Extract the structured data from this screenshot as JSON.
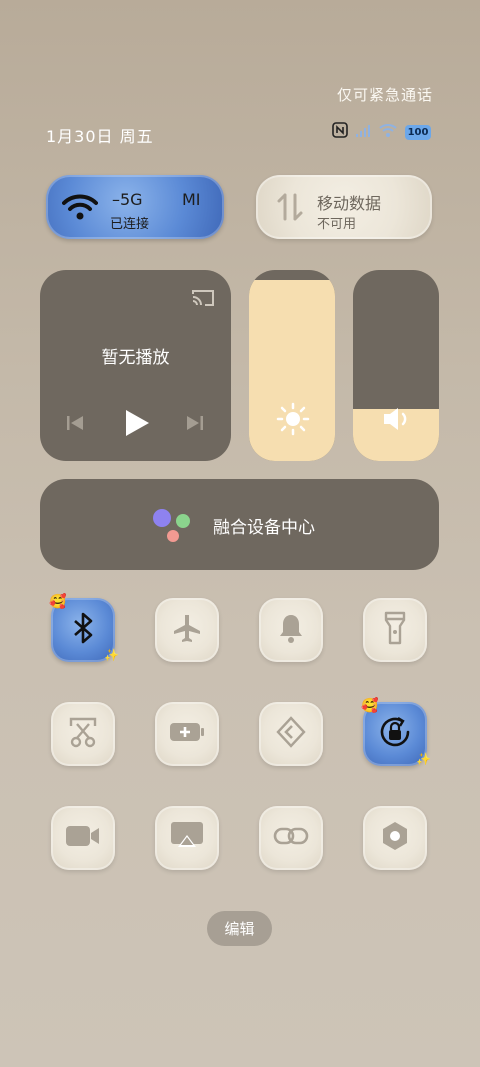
{
  "status_bar": {
    "emergency_text": "仅可紧急通话",
    "date": "1月30日 周五",
    "battery": "100",
    "icons": [
      "nfc-icon",
      "signal-icon",
      "wifi-icon",
      "battery-icon"
    ]
  },
  "wifi_tile": {
    "title": "5G",
    "ssid_partial": "MI",
    "subtitle": "已连接",
    "state": "on"
  },
  "data_tile": {
    "title": "移动数据",
    "subtitle": "不可用",
    "state": "off"
  },
  "media": {
    "status": "暂无播放",
    "icons": [
      "cast-icon",
      "previous-icon",
      "play-icon",
      "next-icon"
    ]
  },
  "brightness": {
    "level": 0.95
  },
  "volume": {
    "level": 0.27
  },
  "device_center": {
    "label": "融合设备中心"
  },
  "tiles": [
    {
      "icon": "bluetooth-icon",
      "state": "on"
    },
    {
      "icon": "airplane-icon",
      "state": "off"
    },
    {
      "icon": "bell-icon",
      "state": "off"
    },
    {
      "icon": "flashlight-icon",
      "state": "off"
    },
    {
      "icon": "screenshot-icon",
      "state": "off"
    },
    {
      "icon": "battery-saver-icon",
      "state": "off"
    },
    {
      "icon": "code-icon",
      "state": "off"
    },
    {
      "icon": "rotation-lock-icon",
      "state": "on"
    },
    {
      "icon": "video-icon",
      "state": "off"
    },
    {
      "icon": "screen-cast-icon",
      "state": "off"
    },
    {
      "icon": "link-icon",
      "state": "off"
    },
    {
      "icon": "settings-icon",
      "state": "off"
    }
  ],
  "edit_button": {
    "label": "编辑"
  },
  "colors": {
    "accent_blue": "#5b8ad6",
    "fill_cream": "#f6deb0",
    "panel_gray": "#6f685f"
  }
}
